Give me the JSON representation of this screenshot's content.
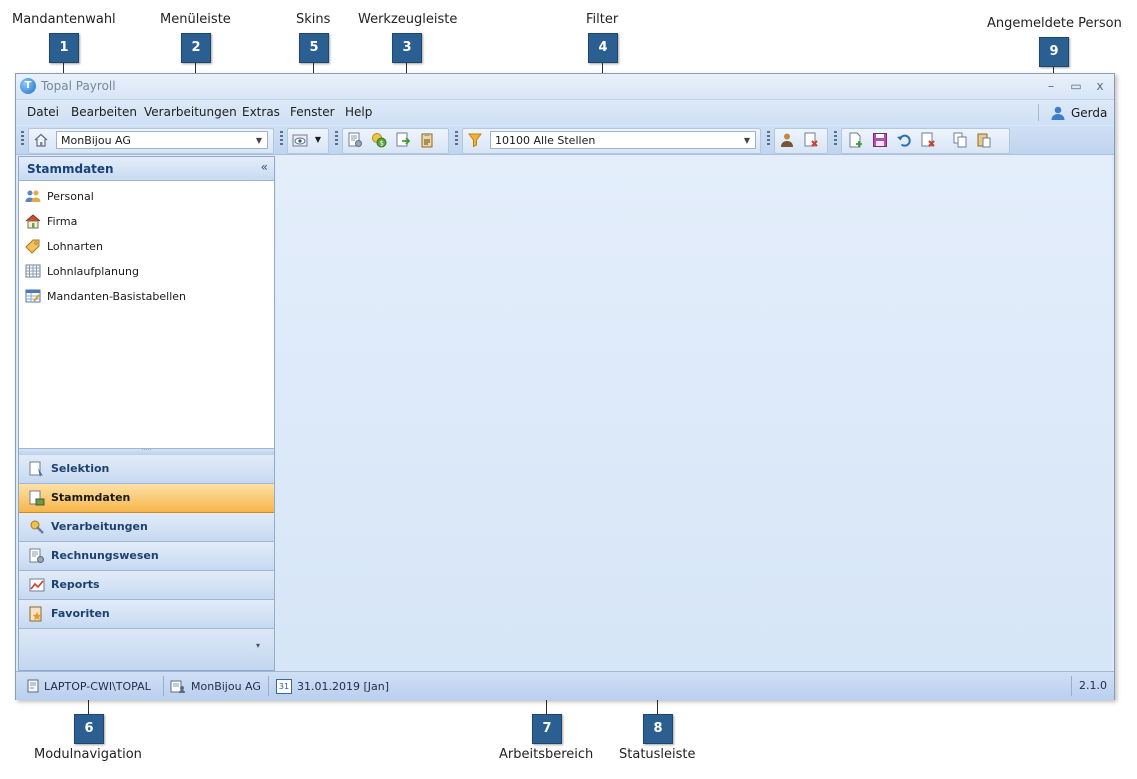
{
  "annotations": [
    {
      "num": "1",
      "label": "Mandantenwahl"
    },
    {
      "num": "2",
      "label": "Menüleiste"
    },
    {
      "num": "5",
      "label": "Skins"
    },
    {
      "num": "3",
      "label": "Werkzeugleiste"
    },
    {
      "num": "4",
      "label": "Filter"
    },
    {
      "num": "9",
      "label": "Angemeldete Person"
    },
    {
      "num": "6",
      "label": "Modulnavigation"
    },
    {
      "num": "7",
      "label": "Arbeitsbereich"
    },
    {
      "num": "8",
      "label": "Statusleiste"
    }
  ],
  "window": {
    "title": "Topal Payroll",
    "controls": {
      "minimize": "–",
      "maximize": "▭",
      "close": "x"
    }
  },
  "menu": [
    "Datei",
    "Bearbeiten",
    "Verarbeitungen",
    "Extras",
    "Fenster",
    "Help"
  ],
  "user": {
    "name": "Gerda",
    "icon": "user-icon"
  },
  "toolbar": {
    "client_select": "MonBijou AG",
    "filter_select": "10100 Alle Stellen",
    "icons": [
      "home-icon",
      "skin-eye-icon",
      "settings-doc-icon",
      "money-icon",
      "export-doc-icon",
      "clipboard-icon",
      "filter-icon",
      "person-icon",
      "delete-doc-icon",
      "new-doc-icon",
      "save-icon",
      "undo-icon",
      "delete-icon",
      "copy-icon",
      "paste-icon"
    ]
  },
  "sidebar": {
    "header": "Stammdaten",
    "collapse": "«",
    "items": [
      {
        "label": "Personal",
        "icon": "people-icon"
      },
      {
        "label": "Firma",
        "icon": "house-icon"
      },
      {
        "label": "Lohnarten",
        "icon": "tag-icon"
      },
      {
        "label": "Lohnlaufplanung",
        "icon": "calendar-grid-icon"
      },
      {
        "label": "Mandanten-Basistabellen",
        "icon": "table-icon"
      }
    ],
    "splitter": "·····",
    "modules": [
      {
        "label": "Selektion",
        "icon": "selection-icon",
        "active": false
      },
      {
        "label": "Stammdaten",
        "icon": "masterdata-icon",
        "active": true
      },
      {
        "label": "Verarbeitungen",
        "icon": "process-icon",
        "active": false
      },
      {
        "label": "Rechnungswesen",
        "icon": "accounting-icon",
        "active": false
      },
      {
        "label": "Reports",
        "icon": "chart-line-icon",
        "active": false
      },
      {
        "label": "Favoriten",
        "icon": "star-icon",
        "active": false
      }
    ],
    "footer_chevron": "▾"
  },
  "statusbar": {
    "computer": "LAPTOP-CWI\\TOPAL",
    "client": "MonBijou AG",
    "date": "31.01.2019 [Jan]",
    "date_icon_text": "31",
    "version": "2.1.0"
  }
}
